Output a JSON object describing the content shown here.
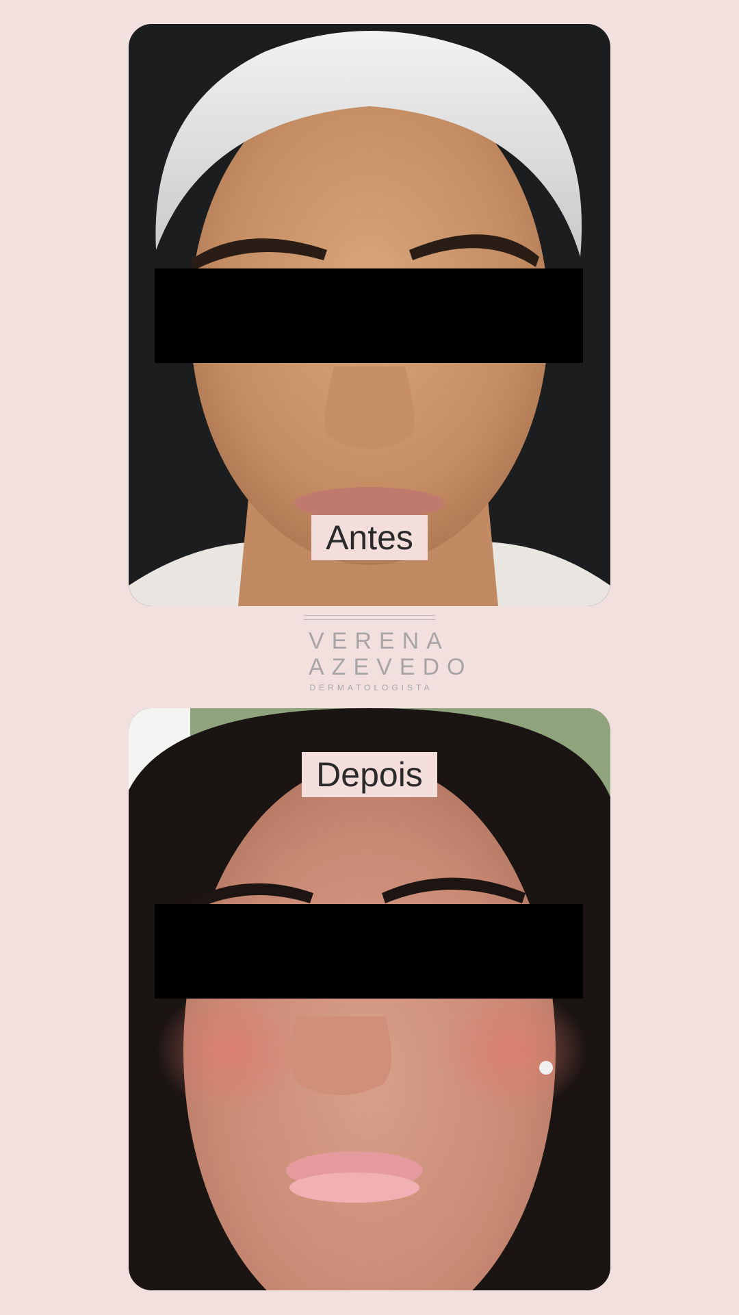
{
  "before": {
    "label": "Antes"
  },
  "after": {
    "label": "Depois"
  },
  "logo": {
    "line1": "VERENA",
    "line2": "AZEVEDO",
    "subtitle": "DERMATOLOGISTA"
  },
  "colors": {
    "background": "#f2e0de",
    "label_bg": "#f3dedb",
    "censor": "#000000",
    "logo_text": "#a8a4a6"
  }
}
